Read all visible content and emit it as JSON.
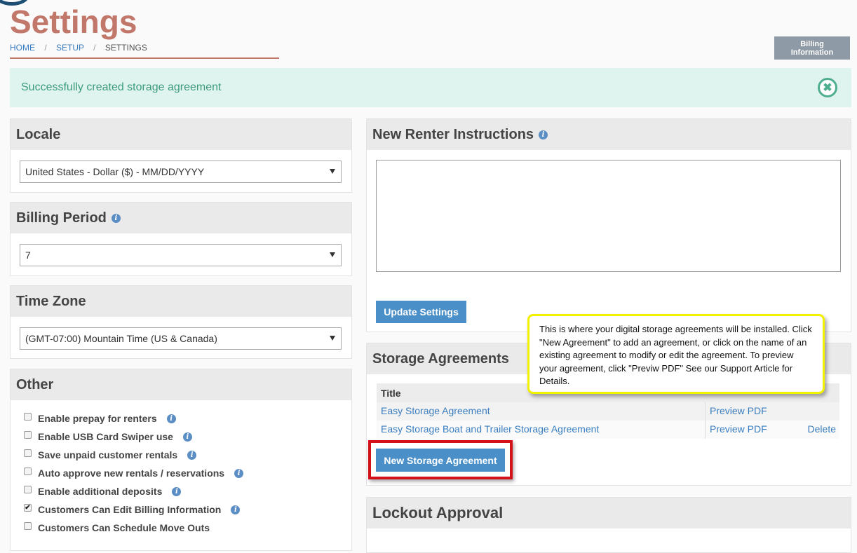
{
  "page": {
    "title": "Settings",
    "breadcrumb": {
      "home": "HOME",
      "setup": "SETUP",
      "current": "SETTINGS",
      "separator": "/"
    },
    "billing_button": "Billing Information"
  },
  "alert": {
    "message": "Successfully created storage agreement",
    "close_glyph": "✖"
  },
  "locale": {
    "heading": "Locale",
    "selected": "United States - Dollar ($) - MM/DD/YYYY"
  },
  "billing_period": {
    "heading": "Billing Period",
    "selected": "7"
  },
  "time_zone": {
    "heading": "Time Zone",
    "selected": "(GMT-07:00) Mountain Time (US & Canada)"
  },
  "other": {
    "heading": "Other",
    "options": [
      {
        "label": "Enable prepay for renters",
        "checked": false
      },
      {
        "label": "Enable USB Card Swiper use",
        "checked": false
      },
      {
        "label": "Save unpaid customer rentals",
        "checked": false
      },
      {
        "label": "Auto approve new rentals / reservations",
        "checked": false
      },
      {
        "label": "Enable additional deposits",
        "checked": false
      },
      {
        "label": "Customers Can Edit Billing Information",
        "checked": true
      },
      {
        "label": "Customers Can Schedule Move Outs",
        "checked": false
      }
    ]
  },
  "renter_instructions": {
    "heading": "New Renter Instructions",
    "text": "",
    "update_button": "Update Settings"
  },
  "storage_agreements": {
    "heading": "Storage Agreements",
    "column_title": "Title",
    "rows": [
      {
        "title": "Easy Storage Agreement",
        "preview": "Preview PDF",
        "delete": ""
      },
      {
        "title": "Easy Storage Boat and Trailer Storage Agreement",
        "preview": "Preview PDF",
        "delete": "Delete"
      }
    ],
    "new_button": "New Storage Agreement"
  },
  "tooltip": {
    "text": "This is where your digital storage agreements will be installed. Click \"New Agreement\" to add an agreement, or click on the name of an existing agreement to modify or edit the agreement. To preview your agreement, click \"Previw PDF\" See our Support Article for Details."
  },
  "lockout": {
    "heading": "Lockout Approval"
  },
  "colors": {
    "title": "#c1776a",
    "link": "#3a7dbf",
    "button": "#4a8fc8",
    "alert_bg": "#dff4ee",
    "highlight": "#d3111b",
    "tooltip_border": "#f1f100"
  }
}
